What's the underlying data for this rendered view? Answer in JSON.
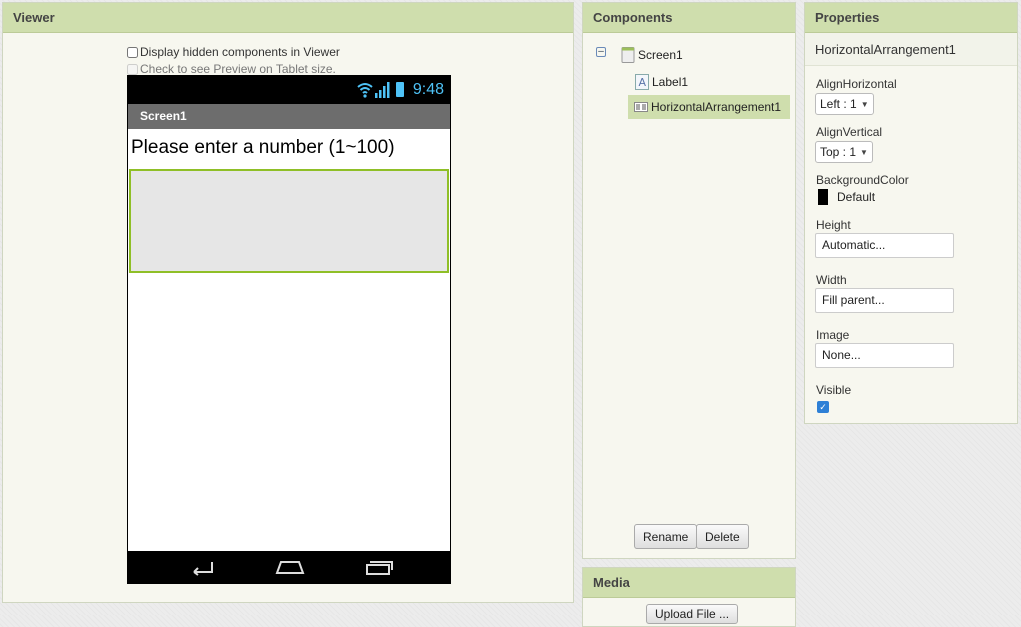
{
  "viewer": {
    "title": "Viewer",
    "hidden_components_label": "Display hidden components in Viewer",
    "tablet_preview_label": "Check to see Preview on Tablet size.",
    "phone": {
      "time": "9:48",
      "screen_title": "Screen1",
      "label_text": "Please enter a number (1~100)"
    }
  },
  "components": {
    "title": "Components",
    "tree": [
      {
        "label": "Screen1",
        "icon": "screen-icon"
      },
      {
        "label": "Label1",
        "icon": "label-icon"
      },
      {
        "label": "HorizontalArrangement1",
        "icon": "horizontal-arrangement-icon",
        "selected": true
      }
    ],
    "rename_label": "Rename",
    "delete_label": "Delete"
  },
  "media": {
    "title": "Media",
    "upload_label": "Upload File ..."
  },
  "properties": {
    "title": "Properties",
    "component_name": "HorizontalArrangement1",
    "align_horizontal_label": "AlignHorizontal",
    "align_horizontal_value": "Left : 1",
    "align_vertical_label": "AlignVertical",
    "align_vertical_value": "Top : 1",
    "background_color_label": "BackgroundColor",
    "background_color_value": "Default",
    "height_label": "Height",
    "height_value": "Automatic...",
    "width_label": "Width",
    "width_value": "Fill parent...",
    "image_label": "Image",
    "image_value": "None...",
    "visible_label": "Visible",
    "visible_checked": true
  },
  "colors": {
    "panel_header": "#cfdead",
    "selection": "#cfdead",
    "arrangement_border": "#8fbf27",
    "status_accent": "#4fc3f7"
  }
}
